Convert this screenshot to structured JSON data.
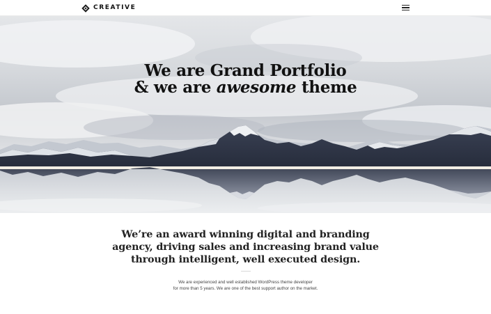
{
  "header": {
    "logo_text": "CREATIVE",
    "logo_icon": "diamond-logo-icon",
    "menu_icon": "hamburger-menu-icon"
  },
  "hero": {
    "title_line1": "We are Grand Portfolio",
    "title_line2_prefix": "& we are ",
    "title_line2_emphasis": "awesome",
    "title_line2_suffix": " theme",
    "image": "snow-capped mountain range reflected in still lake under cloudy sky"
  },
  "intro": {
    "heading_lines": [
      "We’re an award winning digital and branding",
      "agency, driving sales and increasing brand value",
      "through intelligent, well executed design."
    ],
    "body_lines": [
      "We are experienced and well established WordPress theme developer",
      "for more than 5 years. We are one of the best support author on the market."
    ]
  },
  "colors": {
    "text": "#111111",
    "background": "#ffffff",
    "mountain_dark": "#2c3345",
    "sky": "#cfd3d8"
  }
}
